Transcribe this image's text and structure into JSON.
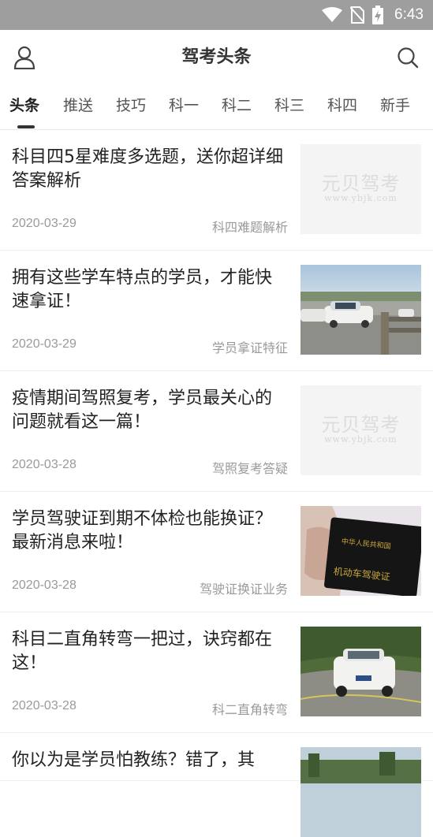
{
  "status_bar": {
    "time": "6:43"
  },
  "app_bar": {
    "title": "驾考头条"
  },
  "tabs": [
    {
      "label": "头条",
      "active": true
    },
    {
      "label": "推送"
    },
    {
      "label": "技巧"
    },
    {
      "label": "科一"
    },
    {
      "label": "科二"
    },
    {
      "label": "科三"
    },
    {
      "label": "科四"
    },
    {
      "label": "新手"
    }
  ],
  "placeholder": {
    "logo": "元贝驾考",
    "url": "www.ybjk.com"
  },
  "articles": [
    {
      "title": "科目四5星难度多选题，送你超详细答案解析",
      "date": "2020-03-29",
      "tag": "科四难题解析",
      "thumb": "placeholder"
    },
    {
      "title": "拥有这些学车特点的学员，才能快速拿证！",
      "date": "2020-03-29",
      "tag": "学员拿证特征",
      "thumb": "driving-school-photo"
    },
    {
      "title": "疫情期间驾照复考，学员最关心的问题就看这一篇！",
      "date": "2020-03-28",
      "tag": "驾照复考答疑",
      "thumb": "placeholder"
    },
    {
      "title": "学员驾驶证到期不体检也能换证？最新消息来啦！",
      "date": "2020-03-28",
      "tag": "驾驶证换证业务",
      "thumb": "license-photo"
    },
    {
      "title": "科目二直角转弯一把过，诀窍都在这！",
      "date": "2020-03-28",
      "tag": "科二直角转弯",
      "thumb": "car-photo"
    },
    {
      "title": "你以为是学员怕教练？错了，其",
      "date": "",
      "tag": "",
      "thumb": "road-photo"
    }
  ],
  "license_cover": {
    "line1": "中华人民共和国",
    "line2": "机动车驾驶证"
  },
  "colors": {
    "status_bar": "#9e9e9e",
    "text_primary": "#222222",
    "text_secondary": "#9a9a9a"
  }
}
